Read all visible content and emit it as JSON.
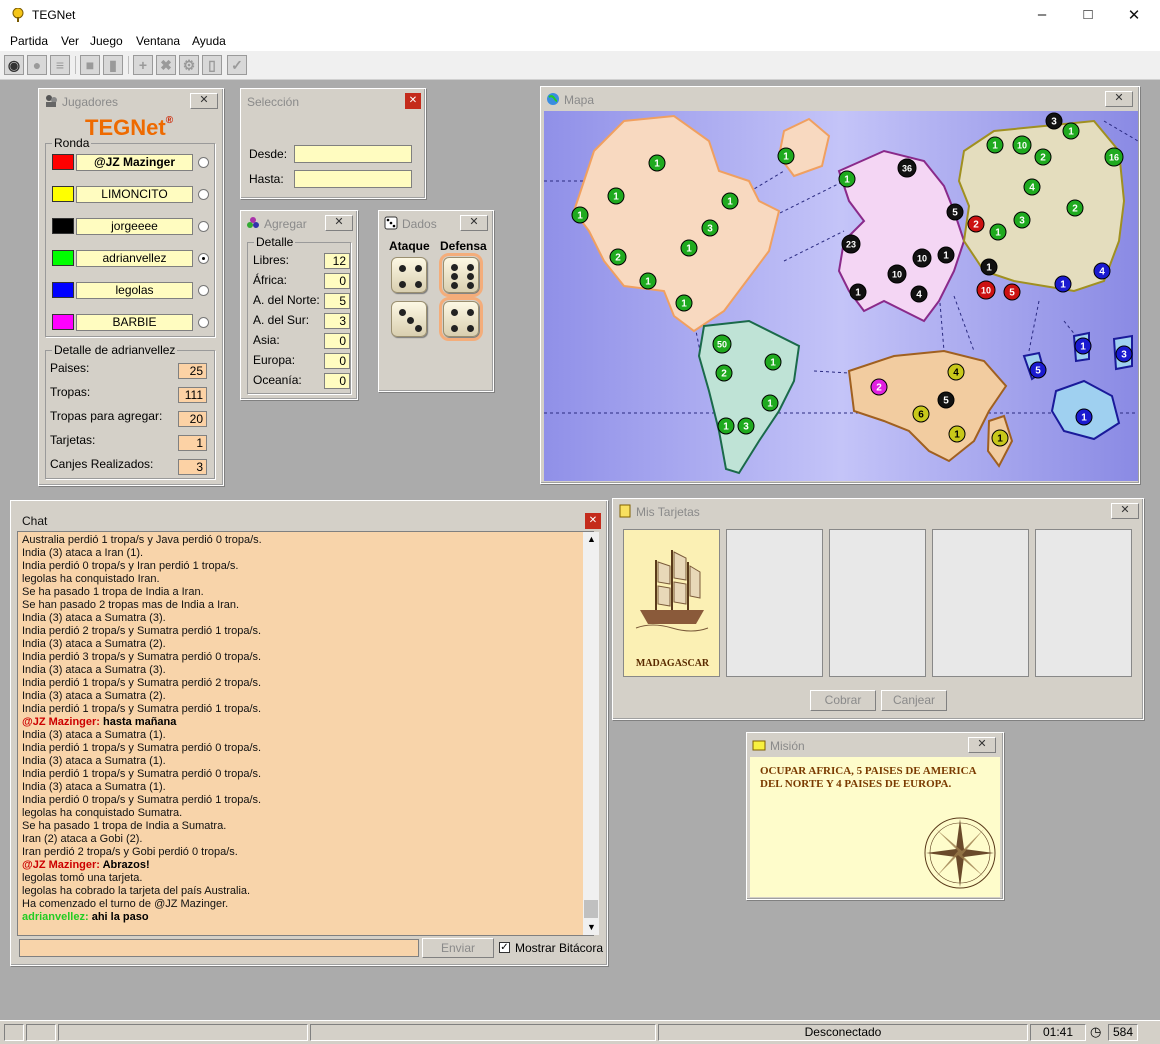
{
  "app": {
    "title": "TEGNet"
  },
  "menu": [
    "Partida",
    "Ver",
    "Juego",
    "Ventana",
    "Ayuda"
  ],
  "jugadores": {
    "title": "Jugadores",
    "logo": "TEGNet",
    "ronda_label": "Ronda",
    "players": [
      {
        "name": "@JZ Mazinger",
        "color": "#ff0000",
        "bold": true,
        "selected": false
      },
      {
        "name": "LIMONCITO",
        "color": "#ffff00",
        "bold": false,
        "selected": false
      },
      {
        "name": "jorgeeee",
        "color": "#000000",
        "bold": false,
        "selected": false
      },
      {
        "name": "adrianvellez",
        "color": "#00ff00",
        "bold": false,
        "selected": true
      },
      {
        "name": "legolas",
        "color": "#0000ff",
        "bold": false,
        "selected": false
      },
      {
        "name": "BARBIE",
        "color": "#ff00ff",
        "bold": false,
        "selected": false
      }
    ],
    "detalle_label": "Detalle de adrianvellez",
    "detalle": [
      {
        "label": "Paises:",
        "value": "25"
      },
      {
        "label": "Tropas:",
        "value": "111"
      },
      {
        "label": "Tropas para agregar:",
        "value": "20"
      },
      {
        "label": "Tarjetas:",
        "value": "1"
      },
      {
        "label": "Canjes Realizados:",
        "value": "3"
      }
    ]
  },
  "seleccion": {
    "title": "Selección",
    "desde_label": "Desde:",
    "hasta_label": "Hasta:",
    "desde": "",
    "hasta": ""
  },
  "agregar": {
    "title": "Agregar",
    "detalle_label": "Detalle",
    "rows": [
      {
        "label": "Libres:",
        "value": "12"
      },
      {
        "label": "África:",
        "value": "0"
      },
      {
        "label": "A. del Norte:",
        "value": "5"
      },
      {
        "label": "A. del Sur:",
        "value": "3"
      },
      {
        "label": "Asia:",
        "value": "0"
      },
      {
        "label": "Europa:",
        "value": "0"
      },
      {
        "label": "Oceanía:",
        "value": "0"
      }
    ]
  },
  "dados": {
    "title": "Dados",
    "ataque_label": "Ataque",
    "defensa_label": "Defensa",
    "ataque": [
      4,
      3
    ],
    "defensa": [
      6,
      4
    ]
  },
  "mapa": {
    "title": "Mapa",
    "colors": {
      "green": "#1faa1f",
      "black": "#111111",
      "blue": "#1a1ad0",
      "red": "#cc1111",
      "yellow": "#c8c81a",
      "magenta": "#e020e0"
    },
    "tokens": [
      {
        "n": "1",
        "c": "green"
      },
      {
        "n": "1",
        "c": "green"
      },
      {
        "n": "1",
        "c": "green"
      },
      {
        "n": "1",
        "c": "green"
      },
      {
        "n": "3",
        "c": "green"
      },
      {
        "n": "1",
        "c": "green"
      },
      {
        "n": "2",
        "c": "green"
      },
      {
        "n": "1",
        "c": "green"
      },
      {
        "n": "1",
        "c": "green"
      },
      {
        "n": "1",
        "c": "green"
      },
      {
        "n": "50",
        "c": "green"
      },
      {
        "n": "1",
        "c": "green"
      },
      {
        "n": "2",
        "c": "green"
      },
      {
        "n": "1",
        "c": "green"
      },
      {
        "n": "1",
        "c": "green"
      },
      {
        "n": "3",
        "c": "green"
      },
      {
        "n": "1",
        "c": "green"
      },
      {
        "n": "36",
        "c": "black"
      },
      {
        "n": "5",
        "c": "black"
      },
      {
        "n": "23",
        "c": "black"
      },
      {
        "n": "10",
        "c": "black"
      },
      {
        "n": "1",
        "c": "black"
      },
      {
        "n": "10",
        "c": "black"
      },
      {
        "n": "1",
        "c": "black"
      },
      {
        "n": "4",
        "c": "black"
      },
      {
        "n": "1",
        "c": "black"
      },
      {
        "n": "10",
        "c": "red"
      },
      {
        "n": "5",
        "c": "red"
      },
      {
        "n": "2",
        "c": "red"
      },
      {
        "n": "1",
        "c": "green"
      },
      {
        "n": "10",
        "c": "green"
      },
      {
        "n": "2",
        "c": "green"
      },
      {
        "n": "1",
        "c": "green"
      },
      {
        "n": "4",
        "c": "green"
      },
      {
        "n": "3",
        "c": "green"
      },
      {
        "n": "2",
        "c": "green"
      },
      {
        "n": "16",
        "c": "green"
      },
      {
        "n": "1",
        "c": "green"
      },
      {
        "n": "1",
        "c": "blue"
      },
      {
        "n": "4",
        "c": "blue"
      },
      {
        "n": "5",
        "c": "blue"
      },
      {
        "n": "1",
        "c": "blue"
      },
      {
        "n": "1",
        "c": "blue"
      },
      {
        "n": "3",
        "c": "blue"
      },
      {
        "n": "2",
        "c": "magenta"
      },
      {
        "n": "4",
        "c": "yellow"
      },
      {
        "n": "5",
        "c": "black"
      },
      {
        "n": "6",
        "c": "yellow"
      },
      {
        "n": "1",
        "c": "yellow"
      },
      {
        "n": "1",
        "c": "yellow"
      },
      {
        "n": "3",
        "c": "black"
      }
    ]
  },
  "chat": {
    "title": "Chat",
    "lines": [
      {
        "text": "Australia perdió 1 tropa/s y Java perdió 0 tropa/s."
      },
      {
        "text": "India (3) ataca a Iran (1)."
      },
      {
        "text": "India perdió 0 tropa/s y Iran perdió 1 tropa/s."
      },
      {
        "text": "legolas ha conquistado Iran."
      },
      {
        "text": "Se ha pasado 1 tropa de India a Iran."
      },
      {
        "text": "Se han pasado 2 tropas mas de India a Iran."
      },
      {
        "text": "India (3) ataca a Sumatra (3)."
      },
      {
        "text": "India perdió 2 tropa/s y Sumatra perdió 1 tropa/s."
      },
      {
        "text": "India (3) ataca a Sumatra (2)."
      },
      {
        "text": "India perdió 3 tropa/s y Sumatra perdió 0 tropa/s."
      },
      {
        "text": "India (3) ataca a Sumatra (3)."
      },
      {
        "text": "India perdió 1 tropa/s y Sumatra perdió 2 tropa/s."
      },
      {
        "text": "India (3) ataca a Sumatra (2)."
      },
      {
        "text": "India perdió 1 tropa/s y Sumatra perdió 1 tropa/s."
      },
      {
        "who": "@JZ Mazinger:",
        "whoColor": "#cc0000",
        "text": " hasta mañana"
      },
      {
        "text": "India (3) ataca a Sumatra (1)."
      },
      {
        "text": "India perdió 1 tropa/s y Sumatra perdió 0 tropa/s."
      },
      {
        "text": "India (3) ataca a Sumatra (1)."
      },
      {
        "text": "India perdió 1 tropa/s y Sumatra perdió 0 tropa/s."
      },
      {
        "text": "India (3) ataca a Sumatra (1)."
      },
      {
        "text": "India perdió 0 tropa/s y Sumatra perdió 1 tropa/s."
      },
      {
        "text": "legolas ha conquistado Sumatra."
      },
      {
        "text": "Se ha pasado 1 tropa de India a Sumatra."
      },
      {
        "text": "Iran (2) ataca a Gobi (2)."
      },
      {
        "text": "Iran perdió 2 tropa/s y Gobi perdió 0 tropa/s."
      },
      {
        "who": "@JZ Mazinger:",
        "whoColor": "#cc0000",
        "text": " Abrazos!"
      },
      {
        "text": "legolas tomó una tarjeta."
      },
      {
        "text": "legolas ha cobrado la tarjeta del país Australia."
      },
      {
        "text": "Ha comenzado el turno de @JZ Mazinger."
      },
      {
        "who": "adrianvellez:",
        "whoColor": "#22cc22",
        "text": " ahi la paso"
      }
    ],
    "input": "",
    "send_label": "Enviar",
    "bitacora_label": "Mostrar Bitácora",
    "bitacora_checked": true
  },
  "tarjetas": {
    "title": "Mis Tarjetas",
    "cards": [
      "MADAGASCAR",
      "",
      "",
      "",
      ""
    ],
    "cobrar_label": "Cobrar",
    "canjear_label": "Canjear"
  },
  "mision": {
    "title": "Misión",
    "text": "OCUPAR AFRICA, 5 PAISES DE AMERICA DEL NORTE Y 4 PAISES DE EUROPA."
  },
  "status": {
    "conexion": "Desconectado",
    "time": "01:41",
    "count": "584"
  }
}
